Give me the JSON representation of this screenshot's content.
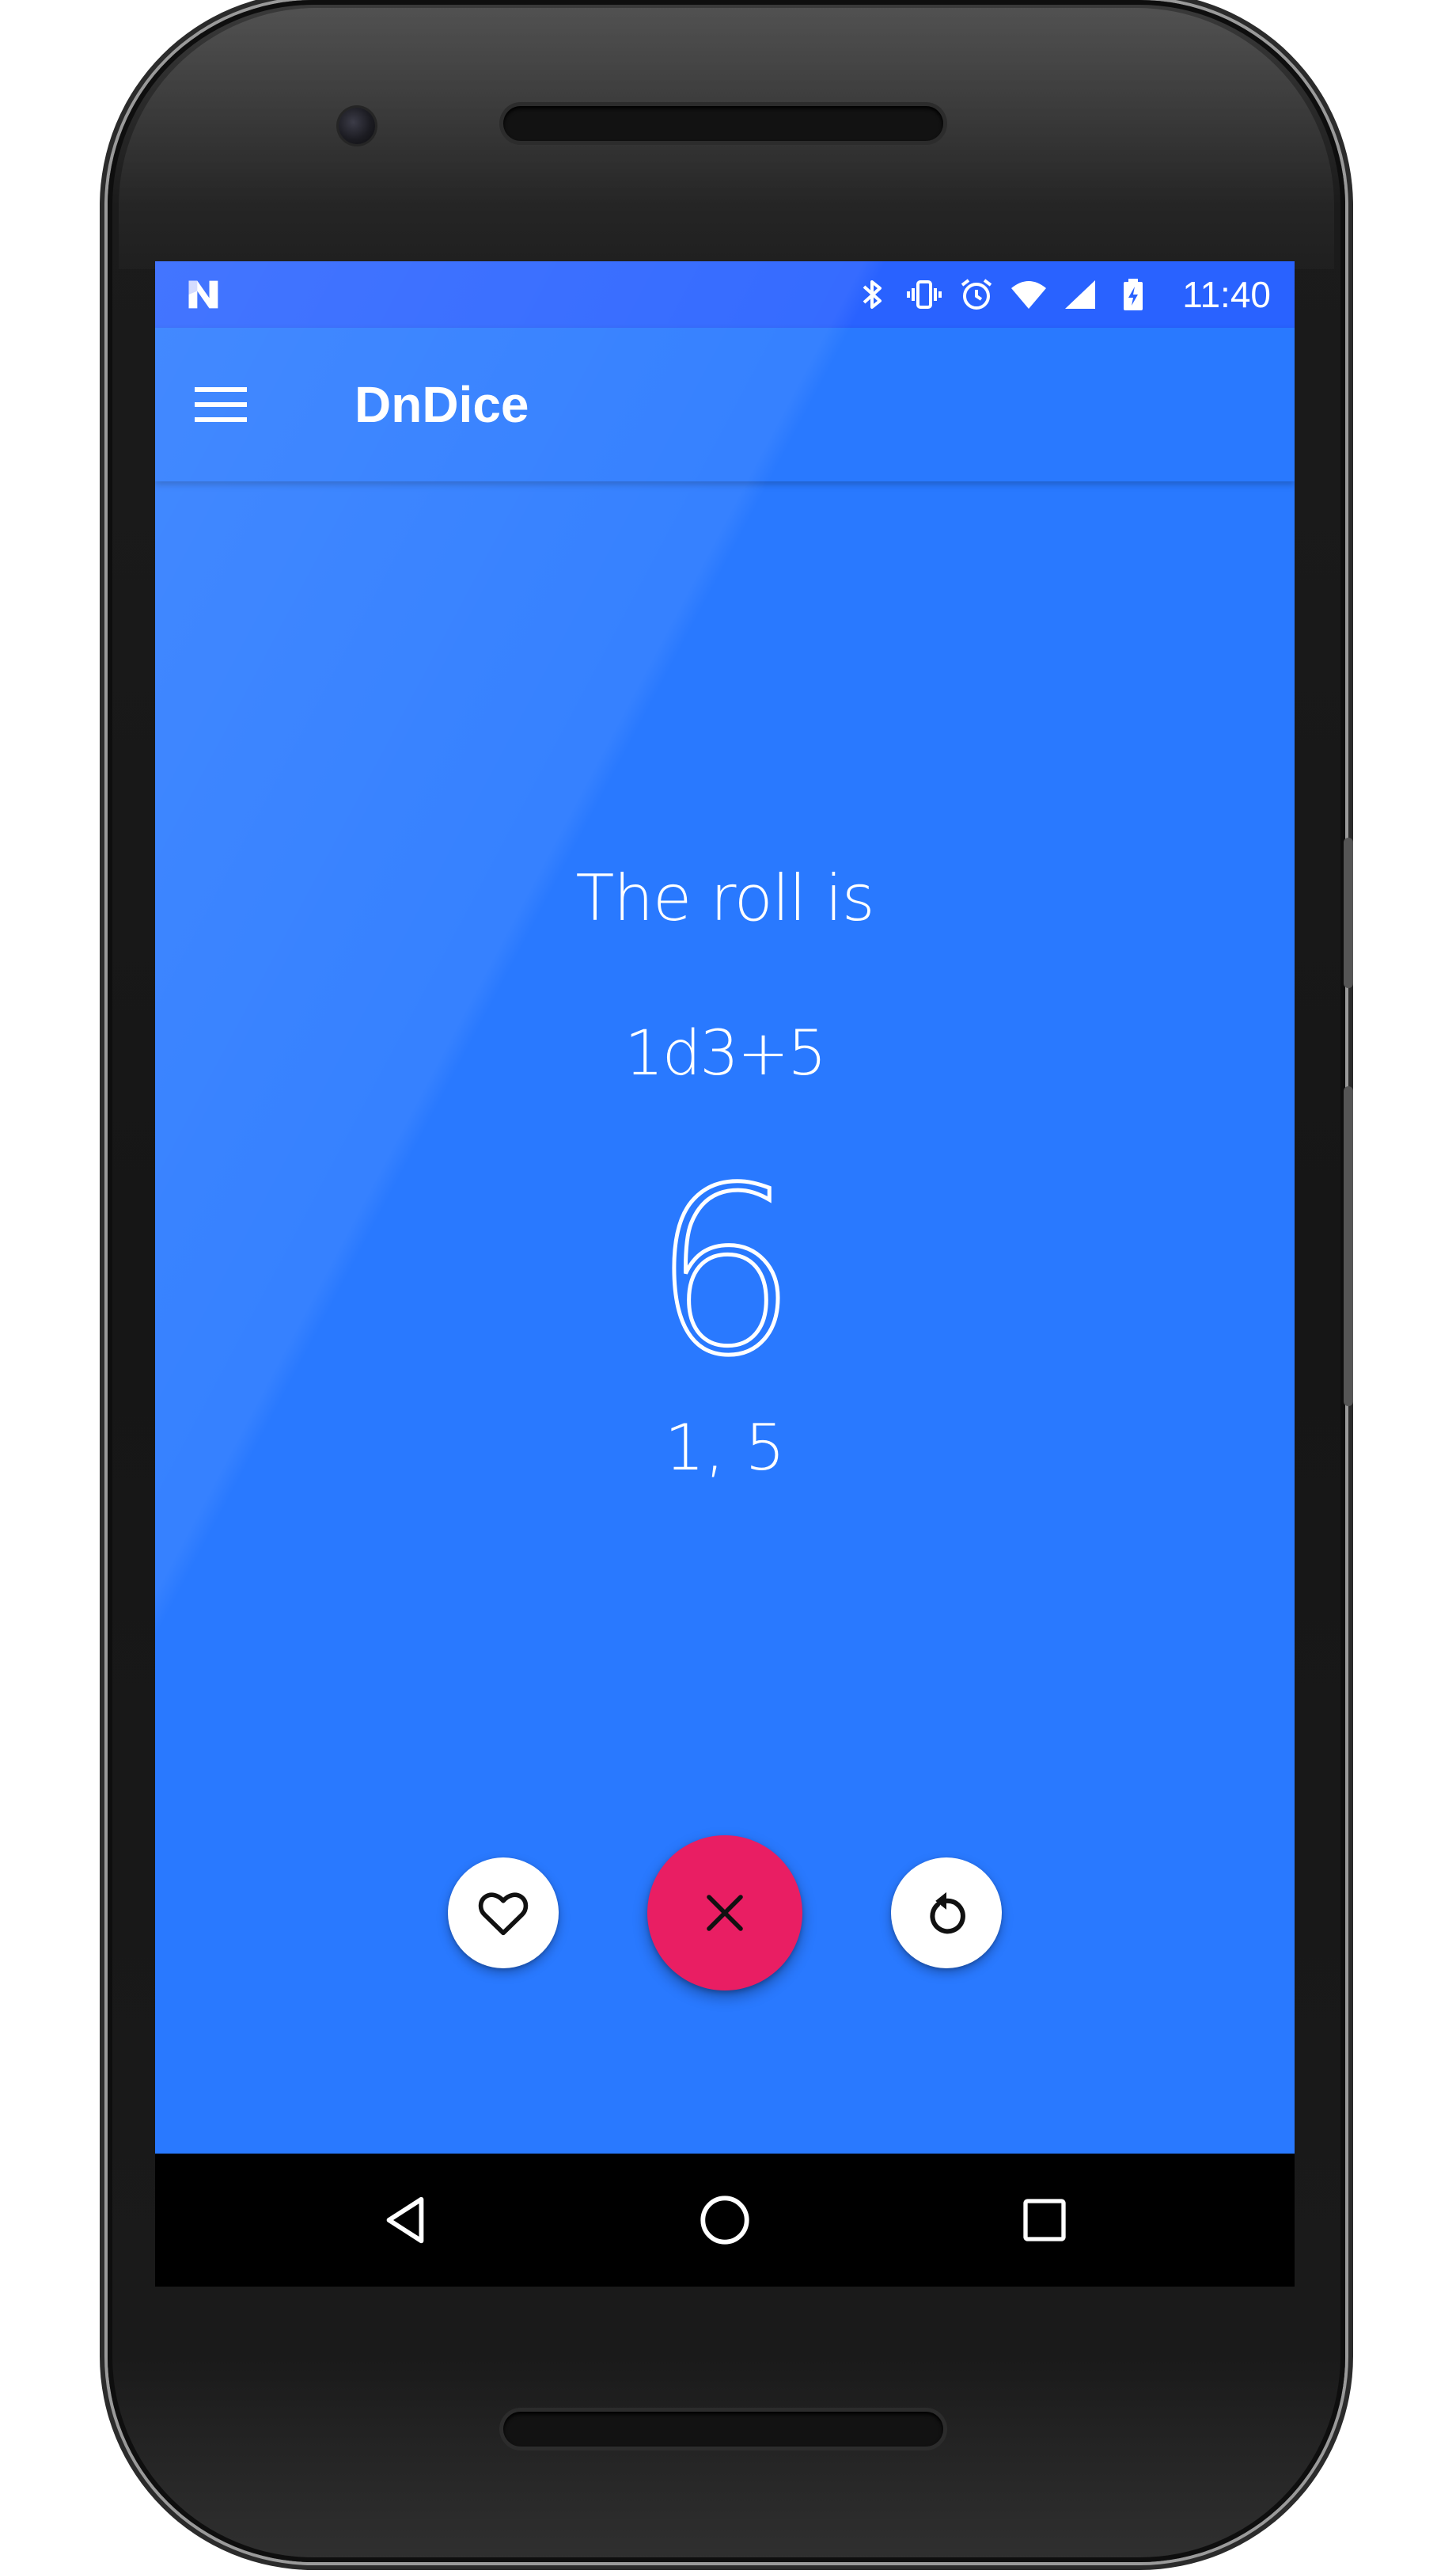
{
  "status_bar": {
    "time": "11:40",
    "icons": [
      "notification-n-icon",
      "bluetooth-icon",
      "vibrate-icon",
      "alarm-icon",
      "wifi-icon",
      "cell-signal-icon",
      "battery-charging-icon"
    ]
  },
  "app_bar": {
    "title": "DnDice",
    "menu_icon": "hamburger-menu-icon"
  },
  "roll": {
    "heading": "The roll is",
    "expression": "1d3+5",
    "total": "6",
    "dice_values": "1, 5"
  },
  "actions": {
    "favorite_icon": "heart-outline-icon",
    "dismiss_icon": "close-icon",
    "reroll_icon": "refresh-icon"
  },
  "nav_bar": {
    "icons": [
      "back-triangle-icon",
      "home-circle-icon",
      "recents-square-icon"
    ]
  },
  "colors": {
    "primary": "#2979ff",
    "status_bar": "#2962ff",
    "accent": "#e91e63",
    "text_on_primary": "#ffffff",
    "nav_bar": "#000000"
  }
}
